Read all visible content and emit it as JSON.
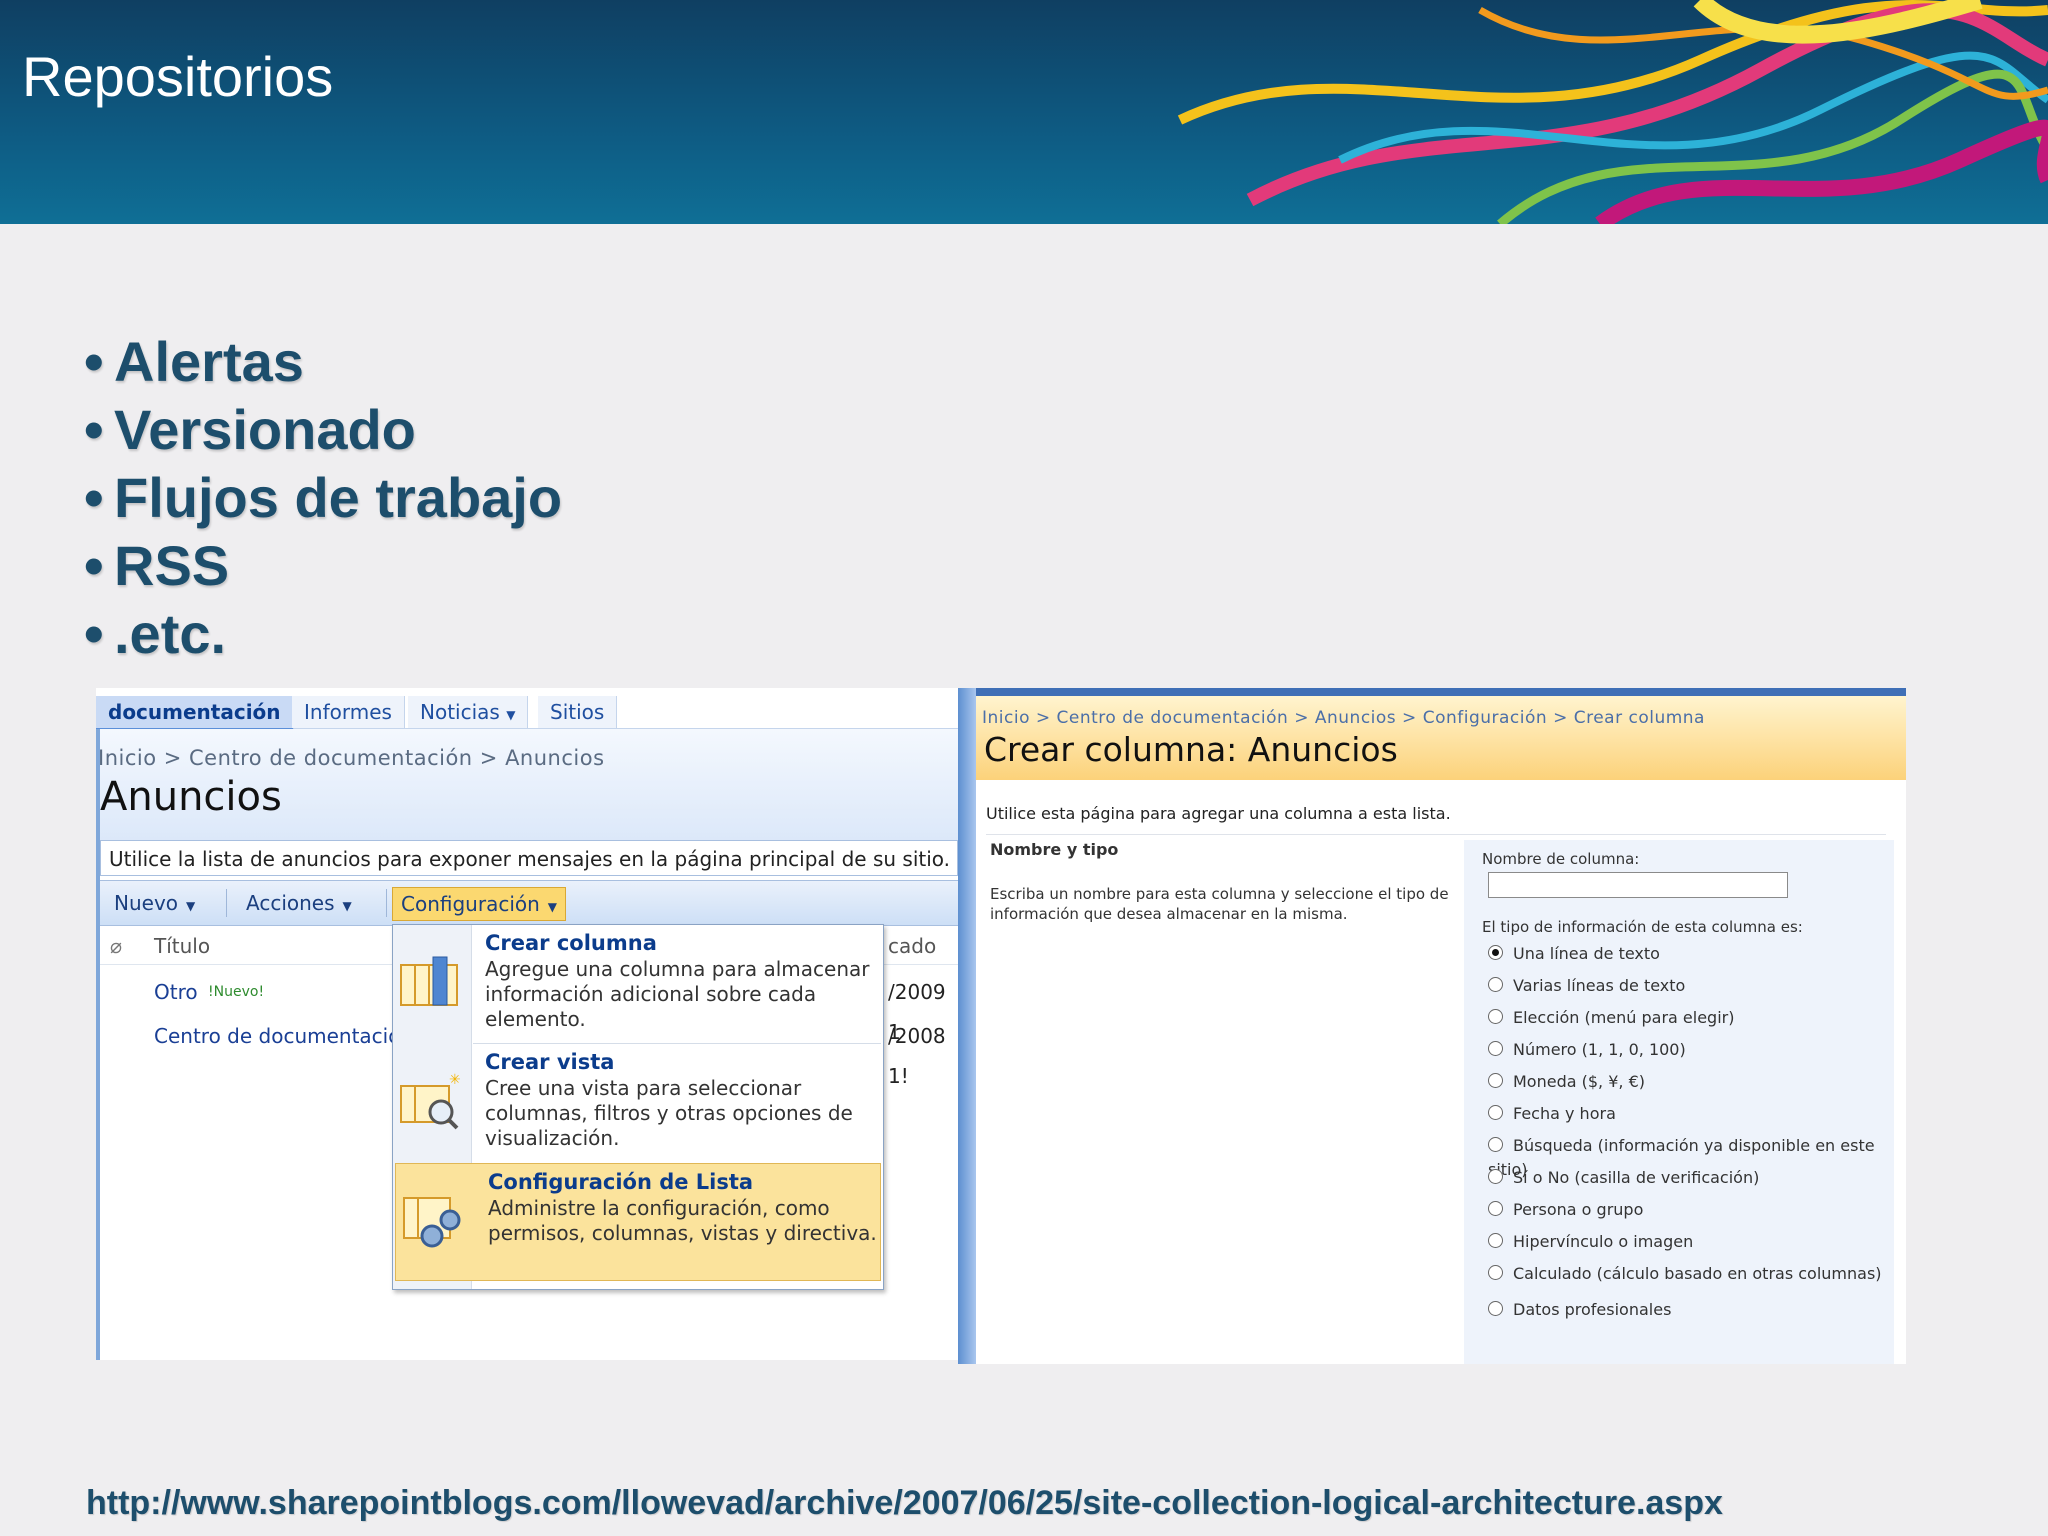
{
  "slide": {
    "title": "Repositorios",
    "bullets": [
      "Alertas",
      "Versionado",
      "Flujos de trabajo",
      "RSS",
      ".etc."
    ],
    "url": "http://www.sharepointblogs.com/llowevad/archive/2007/06/25/site-collection-logical-architecture.aspx"
  },
  "left_screenshot": {
    "tabs": [
      "documentación",
      "Informes",
      "Noticias",
      "Sitios"
    ],
    "breadcrumb": "Inicio > Centro de documentación > Anuncios",
    "title": "Anuncios",
    "description": "Utilice la lista de anuncios para exponer mensajes en la página principal de su sitio.",
    "toolbar": {
      "nuevo": "Nuevo",
      "acciones": "Acciones",
      "configuracion": "Configuración"
    },
    "grid": {
      "col_title": "Título",
      "col_modified": "cado",
      "rows": [
        {
          "title": "Otro",
          "badge": "Nuevo",
          "date": "/2009 1"
        },
        {
          "title": "Centro de documentación",
          "date": "/2008 1!"
        }
      ]
    },
    "menu": [
      {
        "title": "Crear columna",
        "desc": "Agregue una columna para almacenar información adicional sobre cada elemento."
      },
      {
        "title": "Crear vista",
        "desc": "Cree una vista para seleccionar columnas, filtros y otras opciones de visualización."
      },
      {
        "title": "Configuración de Lista",
        "desc": "Administre la configuración, como permisos, columnas, vistas y directiva."
      }
    ]
  },
  "right_screenshot": {
    "breadcrumb": "Inicio > Centro de documentación > Anuncios > Configuración > Crear columna",
    "title": "Crear columna: Anuncios",
    "intro": "Utilice esta página para agregar una columna a esta lista.",
    "section_title": "Nombre y tipo",
    "section_desc": "Escriba un nombre para esta columna y seleccione el tipo de información que desea almacenar en la misma.",
    "column_name_label": "Nombre de columna:",
    "column_name_value": "",
    "type_label": "El tipo de información de esta columna es:",
    "type_options": [
      "Una línea de texto",
      "Varias líneas de texto",
      "Elección (menú para elegir)",
      "Número (1, 1, 0, 100)",
      "Moneda ($, ¥, €)",
      "Fecha y hora",
      "Búsqueda (información ya disponible en este sitio)",
      "Sí o No (casilla de verificación)",
      "Persona o grupo",
      "Hipervínculo o imagen",
      "Calculado (cálculo basado en otras columnas)",
      "Datos profesionales"
    ],
    "selected_option": "Una línea de texto"
  }
}
